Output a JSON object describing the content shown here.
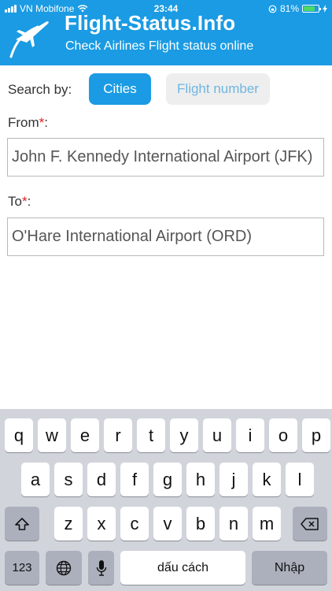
{
  "status_bar": {
    "carrier": "VN Mobifone",
    "time": "23:44",
    "battery": "81%",
    "battery_level": 0.81
  },
  "header": {
    "title": "Flight-Status.Info",
    "subtitle": "Check Airlines Flight status online"
  },
  "search": {
    "label": "Search by:",
    "options": [
      {
        "label": "Cities",
        "selected": true
      },
      {
        "label": "Flight number",
        "selected": false
      }
    ]
  },
  "from": {
    "label": "From",
    "required_mark": "*",
    "colon": ":",
    "value": "John F. Kennedy International Airport (JFK)"
  },
  "to": {
    "label": "To",
    "required_mark": "*",
    "colon": ":",
    "value": "O'Hare International Airport (ORD)"
  },
  "keyboard": {
    "row1": [
      "q",
      "w",
      "e",
      "r",
      "t",
      "y",
      "u",
      "i",
      "o",
      "p"
    ],
    "row2": [
      "a",
      "s",
      "d",
      "f",
      "g",
      "h",
      "j",
      "k",
      "l"
    ],
    "row3": [
      "z",
      "x",
      "c",
      "v",
      "b",
      "n",
      "m"
    ],
    "numbers_label": "123",
    "space_label": "dấu cách",
    "return_label": "Nhập"
  },
  "colors": {
    "brand": "#1a9be3",
    "required": "#e01d1d",
    "keyboard_bg": "#d1d4db"
  }
}
